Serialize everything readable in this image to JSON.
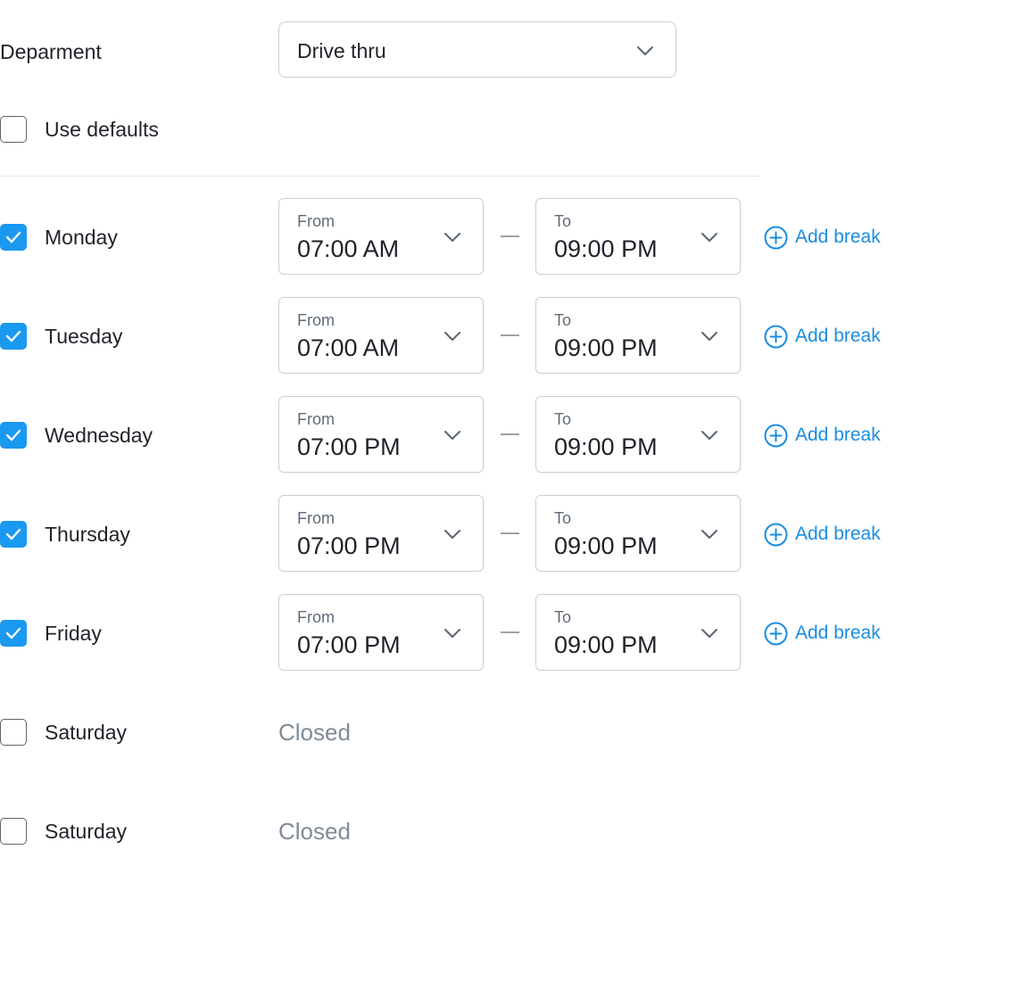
{
  "department": {
    "label": "Deparment",
    "selected": "Drive thru"
  },
  "use_defaults": {
    "label": "Use defaults",
    "checked": false
  },
  "time_labels": {
    "from": "From",
    "to": "To"
  },
  "add_break_label": "Add break",
  "closed_label": "Closed",
  "days": [
    {
      "name": "Monday",
      "checked": true,
      "from": "07:00 AM",
      "to": "09:00 PM"
    },
    {
      "name": "Tuesday",
      "checked": true,
      "from": "07:00 AM",
      "to": "09:00 PM"
    },
    {
      "name": "Wednesday",
      "checked": true,
      "from": "07:00 PM",
      "to": "09:00 PM"
    },
    {
      "name": "Thursday",
      "checked": true,
      "from": "07:00 PM",
      "to": "09:00 PM"
    },
    {
      "name": "Friday",
      "checked": true,
      "from": "07:00 PM",
      "to": "09:00 PM"
    },
    {
      "name": "Saturday",
      "checked": false,
      "status": "Closed"
    },
    {
      "name": "Saturday",
      "checked": false,
      "status": "Closed"
    }
  ],
  "colors": {
    "accent": "#1a99f0",
    "link": "#1a8de0",
    "border": "#c9ced4",
    "muted_text": "#7f8b97"
  }
}
